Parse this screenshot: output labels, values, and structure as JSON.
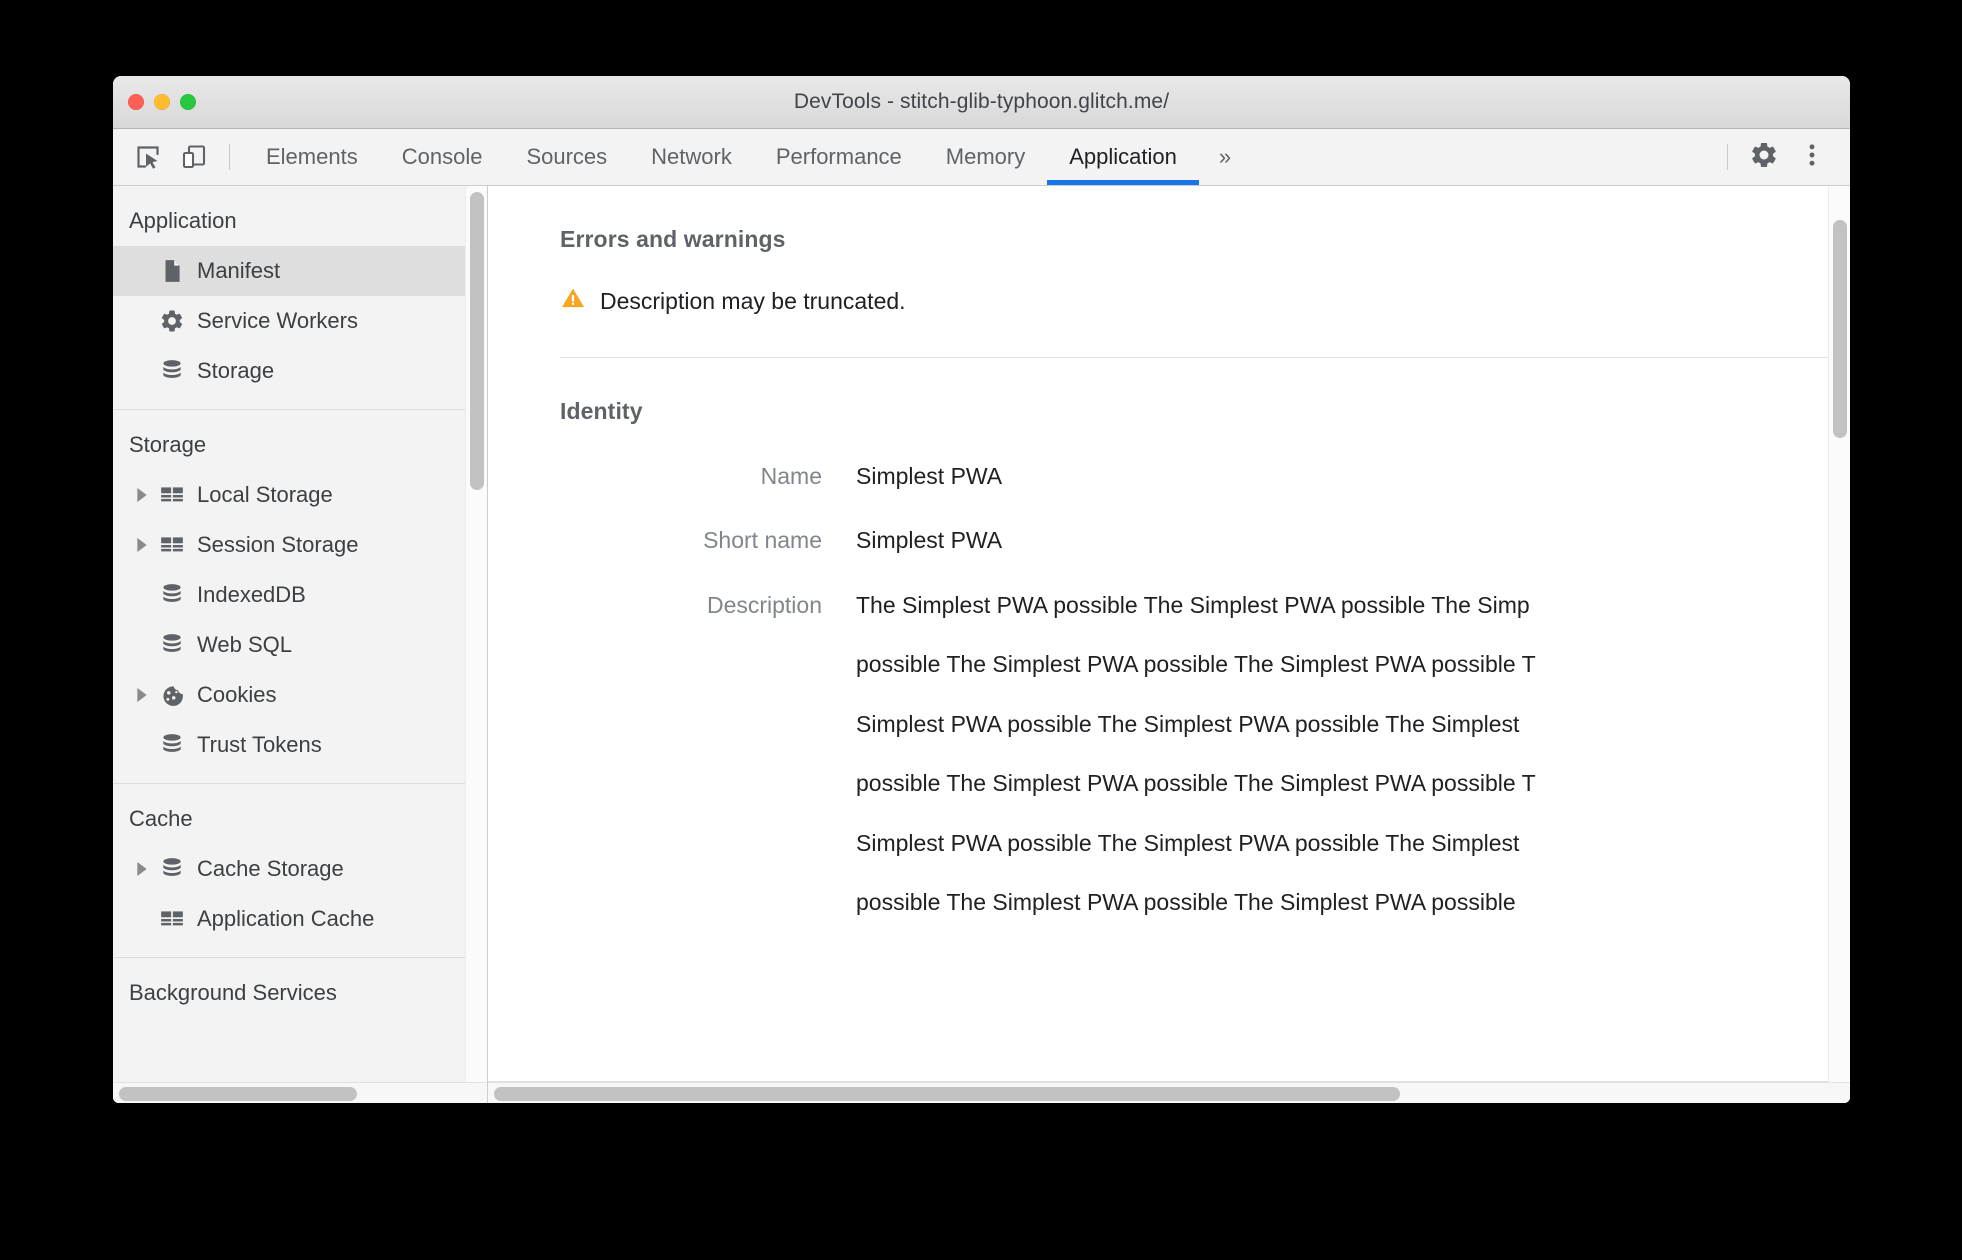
{
  "window": {
    "title": "DevTools - stitch-glib-typhoon.glitch.me/",
    "traffic_lights": {
      "close": "close-button",
      "minimize": "minimize-button",
      "maximize": "maximize-button"
    }
  },
  "toolbar": {
    "inspect_icon": "inspect-element-icon",
    "device_icon": "device-toolbar-icon",
    "tabs": [
      {
        "label": "Elements",
        "active": false
      },
      {
        "label": "Console",
        "active": false
      },
      {
        "label": "Sources",
        "active": false
      },
      {
        "label": "Network",
        "active": false
      },
      {
        "label": "Performance",
        "active": false
      },
      {
        "label": "Memory",
        "active": false
      },
      {
        "label": "Application",
        "active": true
      }
    ],
    "more_tabs_label": "»",
    "settings_icon": "gear-icon",
    "menu_icon": "kebab-menu-icon",
    "active_tab_accent": "#1a73e8"
  },
  "sidebar": {
    "groups": [
      {
        "header": "Application",
        "items": [
          {
            "label": "Manifest",
            "icon": "document-icon",
            "twisty": false,
            "selected": true
          },
          {
            "label": "Service Workers",
            "icon": "gear-icon",
            "twisty": false,
            "selected": false
          },
          {
            "label": "Storage",
            "icon": "database-icon",
            "twisty": false,
            "selected": false
          }
        ]
      },
      {
        "header": "Storage",
        "items": [
          {
            "label": "Local Storage",
            "icon": "table-icon",
            "twisty": true,
            "selected": false
          },
          {
            "label": "Session Storage",
            "icon": "table-icon",
            "twisty": true,
            "selected": false
          },
          {
            "label": "IndexedDB",
            "icon": "database-icon",
            "twisty": false,
            "selected": false
          },
          {
            "label": "Web SQL",
            "icon": "database-icon",
            "twisty": false,
            "selected": false
          },
          {
            "label": "Cookies",
            "icon": "cookie-icon",
            "twisty": true,
            "selected": false
          },
          {
            "label": "Trust Tokens",
            "icon": "database-icon",
            "twisty": false,
            "selected": false
          }
        ]
      },
      {
        "header": "Cache",
        "items": [
          {
            "label": "Cache Storage",
            "icon": "database-icon",
            "twisty": true,
            "selected": false
          },
          {
            "label": "Application Cache",
            "icon": "table-icon",
            "twisty": false,
            "selected": false
          }
        ]
      },
      {
        "header": "Background Services",
        "items": []
      }
    ]
  },
  "main": {
    "errors_section": {
      "title": "Errors and warnings",
      "warning_icon": "warning-triangle-icon",
      "warning_color": "#f5a623",
      "warning_text": "Description may be truncated."
    },
    "identity_section": {
      "title": "Identity",
      "name_label": "Name",
      "name_value": "Simplest PWA",
      "short_name_label": "Short name",
      "short_name_value": "Simplest PWA",
      "description_label": "Description",
      "description_lines": [
        "The Simplest PWA possible The Simplest PWA possible The Simp",
        "possible The Simplest PWA possible The Simplest PWA possible T",
        "Simplest PWA possible The Simplest PWA possible The Simplest",
        "possible The Simplest PWA possible The Simplest PWA possible T",
        "Simplest PWA possible The Simplest PWA possible The Simplest",
        "possible The Simplest PWA possible The Simplest PWA possible"
      ]
    }
  }
}
